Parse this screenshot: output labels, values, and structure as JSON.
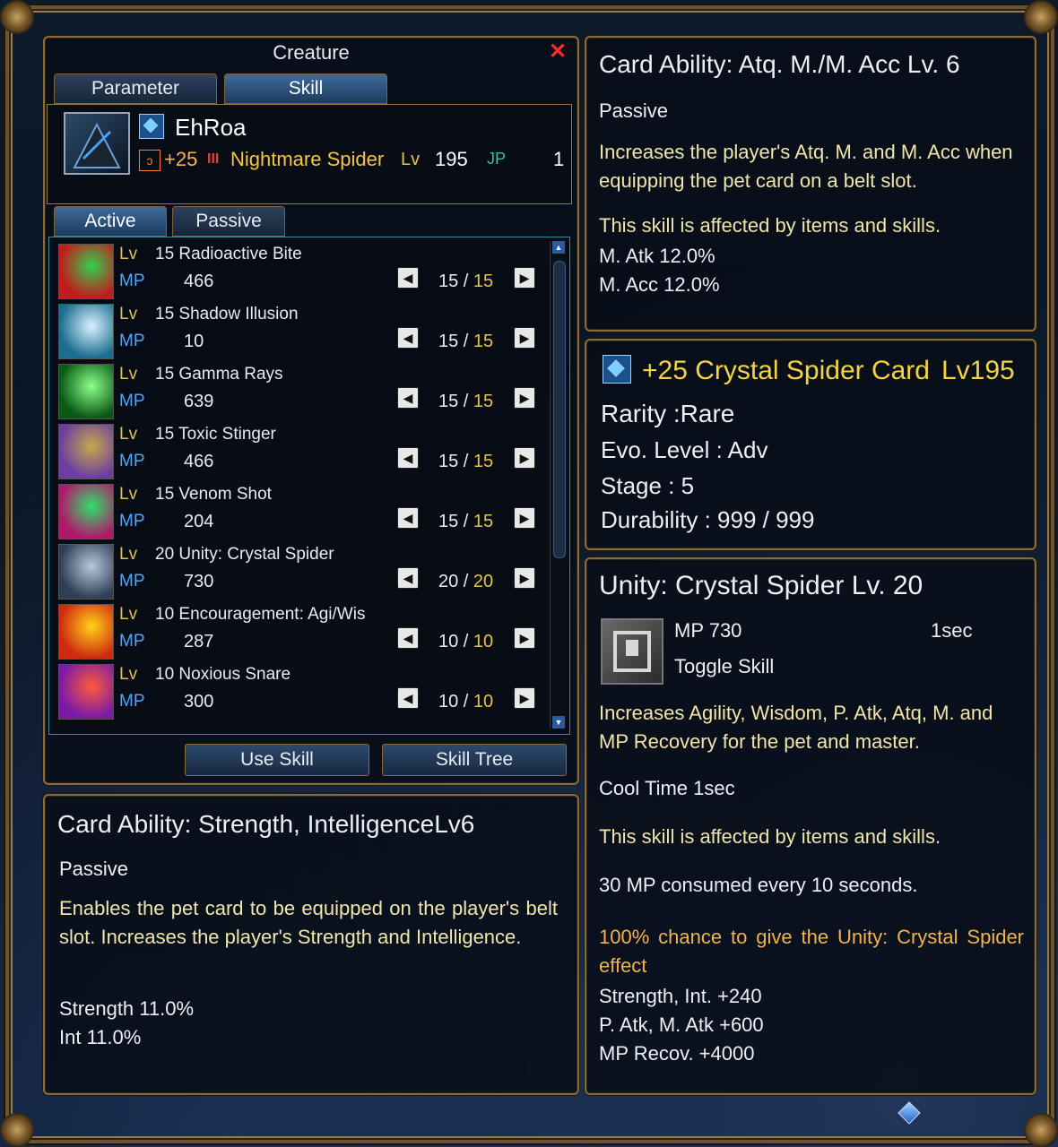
{
  "window": {
    "title": "Creature",
    "close_glyph": "✕",
    "tabs": [
      "Parameter",
      "Skill"
    ],
    "active_tab": "Skill"
  },
  "creature": {
    "name": "EhRoa",
    "enhance": "+25",
    "tier": "III",
    "species": "Nightmare Spider",
    "lv_label": "Lv",
    "level": "195",
    "jp_label": "JP",
    "jp": "1",
    "portrait_icon": "spider-portrait-icon"
  },
  "skill_tabs": [
    "Active",
    "Passive"
  ],
  "skill_labels": {
    "lv": "Lv",
    "mp": "MP"
  },
  "skills": [
    {
      "level": "15",
      "name": "Radioactive Bite",
      "mp": "466",
      "cur": "15",
      "max": "15",
      "icon": "claw-green-icon",
      "c1": "#c21b1b",
      "c2": "#30d050"
    },
    {
      "level": "15",
      "name": "Shadow Illusion",
      "mp": "10",
      "cur": "15",
      "max": "15",
      "icon": "shadow-beast-icon",
      "c1": "#1b6e8f",
      "c2": "#d9f2ff"
    },
    {
      "level": "15",
      "name": "Gamma Rays",
      "mp": "639",
      "cur": "15",
      "max": "15",
      "icon": "green-burst-icon",
      "c1": "#0a5a14",
      "c2": "#8dff8a"
    },
    {
      "level": "15",
      "name": "Toxic Stinger",
      "mp": "466",
      "cur": "15",
      "max": "15",
      "icon": "stinger-icon",
      "c1": "#6a3fa0",
      "c2": "#c8a84a"
    },
    {
      "level": "15",
      "name": "Venom Shot",
      "mp": "204",
      "cur": "15",
      "max": "15",
      "icon": "venom-icon",
      "c1": "#b0186a",
      "c2": "#2fe06a"
    },
    {
      "level": "20",
      "name": "Unity: Crystal Spider",
      "mp": "730",
      "cur": "20",
      "max": "20",
      "icon": "crystal-spider-icon",
      "c1": "#2f3f55",
      "c2": "#b8c8de"
    },
    {
      "level": "10",
      "name": "Encouragement: Agi/Wis",
      "mp": "287",
      "cur": "10",
      "max": "10",
      "icon": "encourage-icon",
      "c1": "#d02a10",
      "c2": "#ffd21a"
    },
    {
      "level": "10",
      "name": "Noxious Snare",
      "mp": "300",
      "cur": "10",
      "max": "10",
      "icon": "snare-icon",
      "c1": "#7a1aa8",
      "c2": "#ff5a3a"
    }
  ],
  "buttons": {
    "use_skill": "Use Skill",
    "skill_tree": "Skill Tree"
  },
  "card_ability_1": {
    "title": "Card Ability: Strength, IntelligenceLv6",
    "type": "Passive",
    "description": "Enables the pet card to be equipped on the player's belt slot. Increases the player's Strength and Intelligence.",
    "stats": [
      "Strength 11.0%",
      "Int 11.0%"
    ]
  },
  "card_ability_2": {
    "title": "Card Ability: Atq. M./M. Acc Lv. 6",
    "type": "Passive",
    "description": "Increases the player's Atq. M. and M. Acc when equipping the pet card on a belt slot.",
    "note": "This skill is affected by items and skills.",
    "stats": [
      "M. Atk 12.0%",
      "M. Acc 12.0%"
    ]
  },
  "card_info": {
    "title": "+25 Crystal Spider Card",
    "level": "Lv195",
    "rarity": "Rarity :Rare",
    "evo": "Evo. Level : Adv",
    "stage": "Stage : 5",
    "durability": "Durability : 999 / 999"
  },
  "unity_skill": {
    "title": "Unity: Crystal Spider Lv. 20",
    "mp": "MP 730",
    "cast": "1sec",
    "kind": "Toggle Skill",
    "description": "Increases Agility, Wisdom, P. Atk, Atq, M. and MP Recovery for the pet and master.",
    "cooltime": "Cool Time 1sec",
    "note": "This skill is affected by items and skills.",
    "consume": "30 MP consumed every 10 seconds.",
    "chance": "100% chance to give the Unity: Crystal Spider effect",
    "effects": [
      "Strength, Int. +240",
      "P. Atk, M. Atk +600",
      "MP Recov. +4000"
    ]
  },
  "colors": {
    "frame": "#8a6c3c",
    "accent_blue": "#4ea7ff",
    "gold": "#e6c24a",
    "card_title": "#f5d442"
  }
}
